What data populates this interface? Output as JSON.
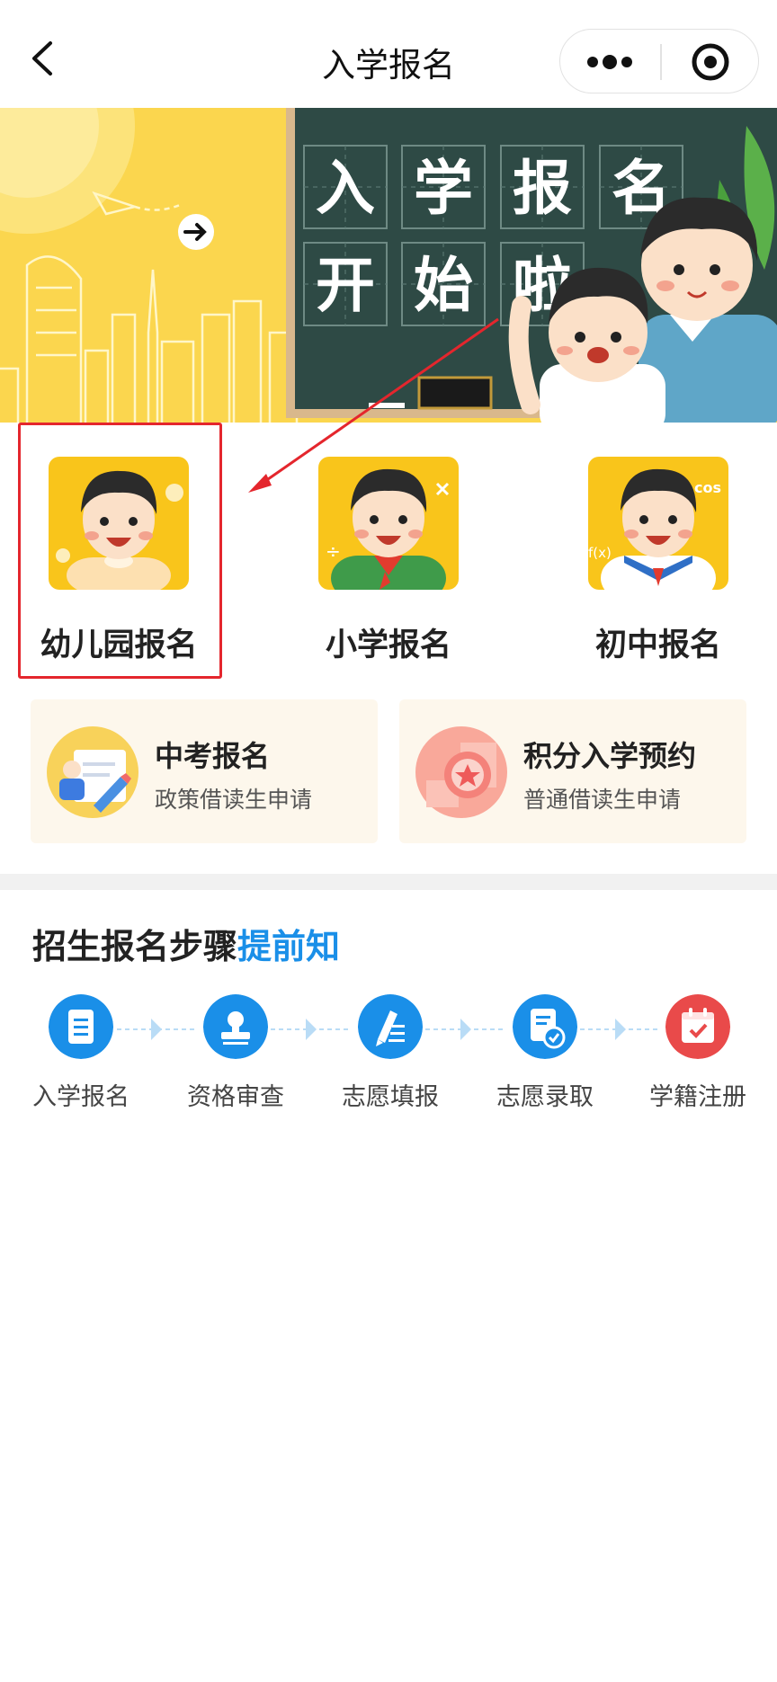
{
  "navbar": {
    "title": "入学报名",
    "back_icon": "chevron-left-icon",
    "more_icon": "more-dots-icon",
    "close_icon": "target-close-icon"
  },
  "banner": {
    "chalkboard_chars": [
      "入",
      "学",
      "报",
      "名",
      "开",
      "始",
      "啦"
    ],
    "colors": {
      "sky": "#fbd64e",
      "board": "#2e4a45",
      "frame": "#d9b88c"
    }
  },
  "levels": [
    {
      "label": "幼儿园报名",
      "accent": "#f9c51b"
    },
    {
      "label": "小学报名",
      "accent": "#f9c51b"
    },
    {
      "label": "初中报名",
      "accent": "#f9c51b"
    }
  ],
  "cards": [
    {
      "title": "中考报名",
      "subtitle": "政策借读生申请"
    },
    {
      "title": "积分入学预约",
      "subtitle": "普通借读生申请"
    }
  ],
  "steps": {
    "title_main": "招生报名步骤",
    "title_highlight": "提前知",
    "items": [
      {
        "label": "入学报名",
        "icon": "document-list-icon",
        "color": "#1a8fe8"
      },
      {
        "label": "资格审查",
        "icon": "stamp-icon",
        "color": "#1a8fe8"
      },
      {
        "label": "志愿填报",
        "icon": "pen-edit-icon",
        "color": "#1a8fe8"
      },
      {
        "label": "志愿录取",
        "icon": "file-check-icon",
        "color": "#1a8fe8"
      },
      {
        "label": "学籍注册",
        "icon": "calendar-check-icon",
        "color": "#e94a4a"
      }
    ]
  },
  "annotation": {
    "color": "#e4262d"
  }
}
